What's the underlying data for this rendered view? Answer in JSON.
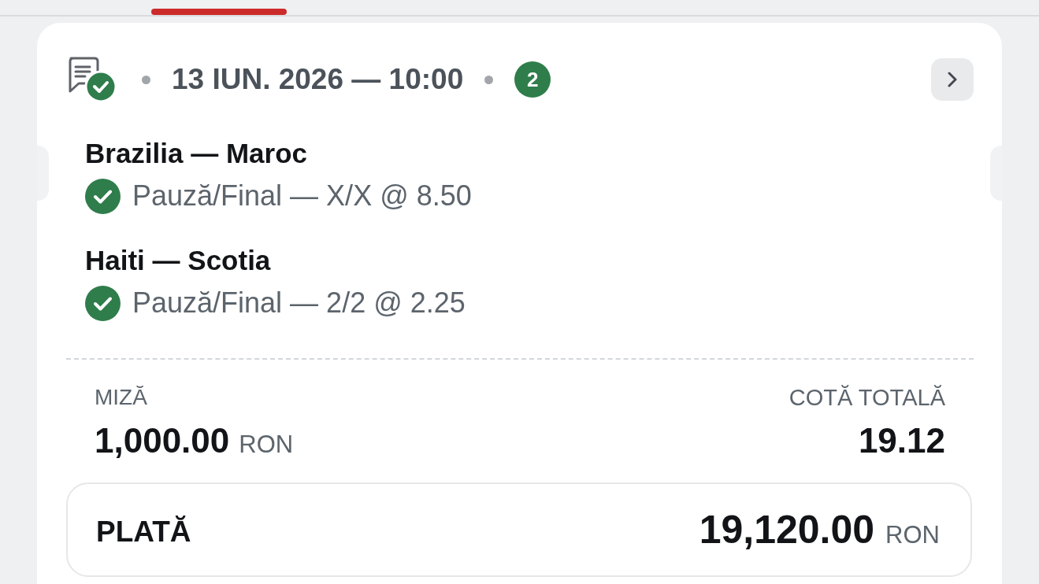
{
  "ticket": {
    "won": true,
    "date": "13 IUN. 2026 — 10:00",
    "selection_count": "2",
    "selections": [
      {
        "match": "Brazilia — Maroc",
        "pick": "Pauză/Final — X/X @ 8.50",
        "won": true
      },
      {
        "match": "Haiti — Scotia",
        "pick": "Pauză/Final — 2/2 @ 2.25",
        "won": true
      }
    ],
    "stake": {
      "label": "MIZĂ",
      "amount": "1,000.00",
      "currency": "RON"
    },
    "total_odds": {
      "label": "COTĂ TOTALĂ",
      "value": "19.12"
    },
    "payout": {
      "label": "PLATĂ",
      "amount": "19,120.00",
      "currency": "RON"
    }
  }
}
